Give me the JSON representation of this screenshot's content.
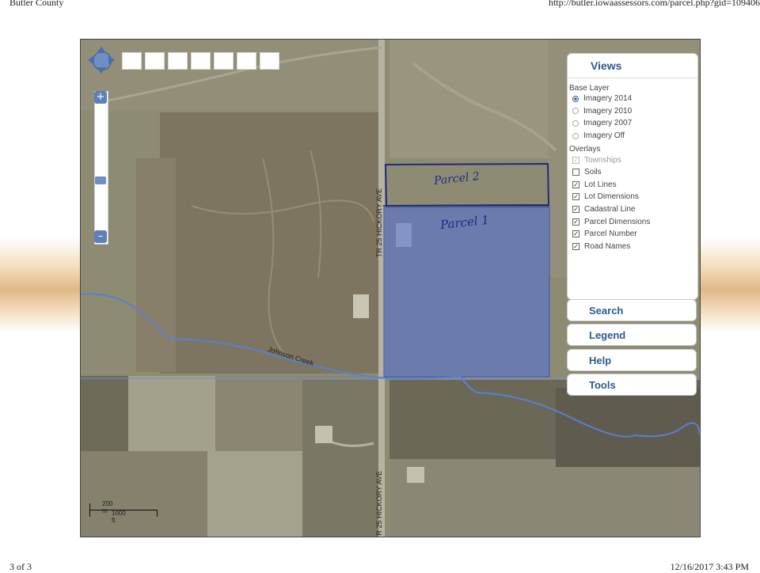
{
  "page": {
    "header_left": "Butler County",
    "header_right": "http://butler.iowaassessors.com/parcel.php?gid=109406",
    "footer_left": "3 of 3",
    "footer_right": "12/16/2017  3:43 PM"
  },
  "map": {
    "road_label_upper": "TR 25 HICKORY AVE",
    "road_label_lower": "TR 25 HICKORY AVE",
    "creek_label": "Johnson Creek",
    "annotations": {
      "parcel_2": "Parcel 2",
      "parcel_1": "Parcel 1"
    },
    "scale": {
      "metric": "200 m",
      "imperial": "1000 ft"
    },
    "zoom": {
      "plus": "+",
      "minus": "–"
    },
    "colors": {
      "parcel_highlight": "#4f6fd8",
      "creek": "#5a7fd0"
    }
  },
  "panel": {
    "views": {
      "title": "Views",
      "base_layer_heading": "Base Layer",
      "base_layers": [
        {
          "label": "Imagery 2014",
          "selected": true
        },
        {
          "label": "Imagery 2010",
          "selected": false
        },
        {
          "label": "Imagery 2007",
          "selected": false
        },
        {
          "label": "Imagery Off",
          "selected": false
        }
      ],
      "overlays_heading": "Overlays",
      "overlays": [
        {
          "label": "Townships",
          "checked": true,
          "enabled": false
        },
        {
          "label": "Soils",
          "checked": false,
          "enabled": true
        },
        {
          "label": "Lot Lines",
          "checked": true,
          "enabled": true
        },
        {
          "label": "Lot Dimensions",
          "checked": true,
          "enabled": true
        },
        {
          "label": "Cadastral Line",
          "checked": true,
          "enabled": true
        },
        {
          "label": "Parcel Dimensions",
          "checked": true,
          "enabled": true
        },
        {
          "label": "Parcel Number",
          "checked": true,
          "enabled": true
        },
        {
          "label": "Road Names",
          "checked": true,
          "enabled": true
        }
      ]
    },
    "search": "Search",
    "legend": "Legend",
    "help": "Help",
    "tools": "Tools"
  }
}
